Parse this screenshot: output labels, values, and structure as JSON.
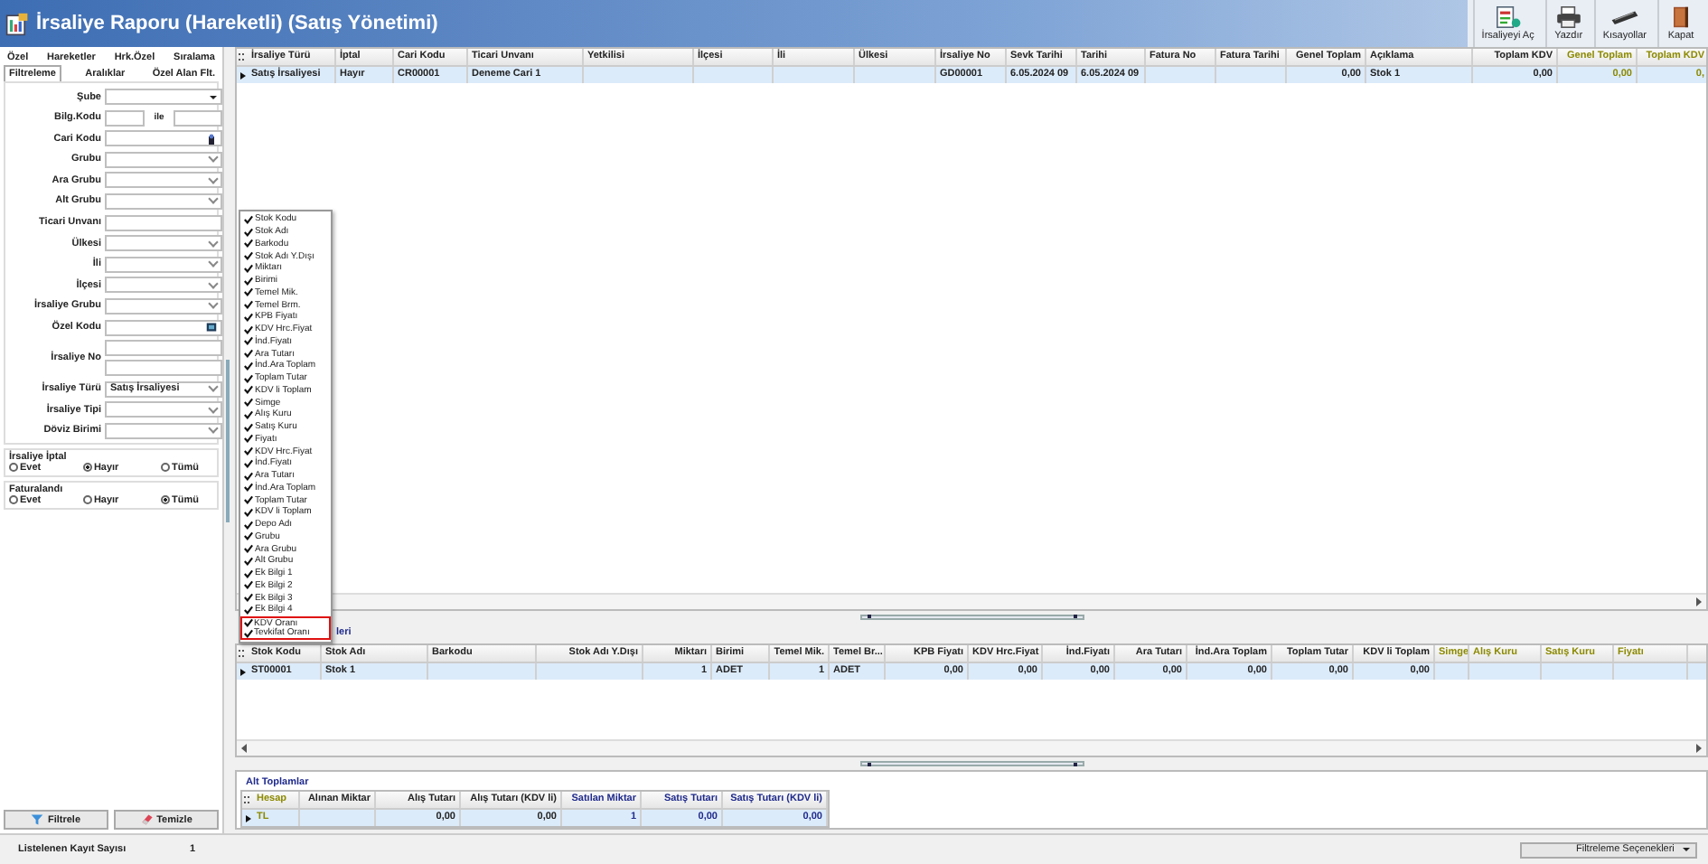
{
  "window": {
    "title": "İrsaliye Raporu (Hareketli) (Satış Yönetimi)"
  },
  "toolbar": [
    {
      "label": "İrsaliyeyi Aç",
      "kind": "document"
    },
    {
      "label": "Yazdır",
      "kind": "printer"
    },
    {
      "label": "Kısayollar",
      "kind": "keyboard"
    },
    {
      "label": "Kapat",
      "kind": "book"
    }
  ],
  "left_panel": {
    "tab_rows": [
      [
        {
          "label": "Özel",
          "selected": false
        },
        {
          "label": "Hareketler",
          "selected": false
        },
        {
          "label": "Hrk.Özel",
          "selected": false
        },
        {
          "label": "Sıralama",
          "selected": false
        }
      ],
      [
        {
          "label": "Filtreleme",
          "selected": true
        },
        {
          "label": "Aralıklar",
          "selected": false
        },
        {
          "label": "Özel Alan Flt.",
          "selected": false
        }
      ]
    ],
    "fields": [
      {
        "label": "Şube",
        "kind": "select"
      },
      {
        "label": "Bilg.Kodu",
        "kind": "range",
        "separator": "ile"
      },
      {
        "label": "Cari Kodu",
        "kind": "lookup"
      },
      {
        "label": "Grubu",
        "kind": "dropdown"
      },
      {
        "label": "Ara Grubu",
        "kind": "dropdown"
      },
      {
        "label": "Alt Grubu",
        "kind": "dropdown"
      },
      {
        "label": "Ticari Unvanı",
        "kind": "text"
      },
      {
        "label": "Ülkesi",
        "kind": "dropdown"
      },
      {
        "label": "İli",
        "kind": "dropdown"
      },
      {
        "label": "İlçesi",
        "kind": "dropdown"
      },
      {
        "label": "İrsaliye Grubu",
        "kind": "dropdown"
      },
      {
        "label": "Özel Kodu",
        "kind": "picker"
      },
      {
        "label": "İrsaliye No",
        "kind": "double"
      },
      {
        "label": "İrsaliye Türü",
        "kind": "dropdown",
        "value": "Satış İrsaliyesi"
      },
      {
        "label": "İrsaliye Tipi",
        "kind": "dropdown"
      },
      {
        "label": "Döviz Birimi",
        "kind": "dropdown"
      }
    ],
    "radio_groups": [
      {
        "title": "İrsaliye İptal",
        "options": [
          {
            "label": "Evet",
            "selected": false
          },
          {
            "label": "Hayır",
            "selected": true
          },
          {
            "label": "Tümü",
            "selected": false
          }
        ]
      },
      {
        "title": "Faturalandı",
        "options": [
          {
            "label": "Evet",
            "selected": false
          },
          {
            "label": "Hayır",
            "selected": false
          },
          {
            "label": "Tümü",
            "selected": true
          }
        ]
      }
    ],
    "buttons": [
      {
        "label": "Filtrele",
        "kind": "filter"
      },
      {
        "label": "Temizle",
        "kind": "eraser"
      }
    ]
  },
  "main_grid": {
    "columns": [
      {
        "label": "İrsaliye Türü",
        "color": "#222222"
      },
      {
        "label": "İptal",
        "color": "#222222"
      },
      {
        "label": "Cari Kodu",
        "color": "#222222"
      },
      {
        "label": "Ticari Unvanı",
        "color": "#222222"
      },
      {
        "label": "Yetkilisi",
        "color": "#222222"
      },
      {
        "label": "İlçesi",
        "color": "#222222"
      },
      {
        "label": "İli",
        "color": "#222222"
      },
      {
        "label": "Ülkesi",
        "color": "#222222"
      },
      {
        "label": "İrsaliye No",
        "color": "#222222"
      },
      {
        "label": "Sevk Tarihi",
        "color": "#222222"
      },
      {
        "label": "Tarihi",
        "color": "#222222"
      },
      {
        "label": "Fatura No",
        "color": "#222222"
      },
      {
        "label": "Fatura Tarihi",
        "color": "#222222"
      },
      {
        "label": "Genel Toplam",
        "color": "#222222"
      },
      {
        "label": "Açıklama",
        "color": "#222222"
      },
      {
        "label": "Toplam KDV",
        "color": "#222222"
      },
      {
        "label": "Genel Toplam",
        "color": "#8c8a00"
      },
      {
        "label": "Toplam KDV",
        "color": "#8c8a00"
      }
    ],
    "rows": [
      [
        "Satış İrsaliyesi",
        "Hayır",
        "CR00001",
        "Deneme Cari 1",
        null,
        null,
        null,
        null,
        "GD00001",
        "6.05.2024 09",
        "6.05.2024 09",
        null,
        null,
        "0,00",
        "Stok 1",
        "0,00",
        "0,00",
        "0,"
      ]
    ]
  },
  "column_menu": {
    "items": [
      {
        "label": "Stok Kodu",
        "checked": true,
        "boxed": false
      },
      {
        "label": "Stok Adı",
        "checked": true,
        "boxed": false
      },
      {
        "label": "Barkodu",
        "checked": true,
        "boxed": false
      },
      {
        "label": "Stok Adı Y.Dışı",
        "checked": true,
        "boxed": false
      },
      {
        "label": "Miktarı",
        "checked": true,
        "boxed": false
      },
      {
        "label": "Birimi",
        "checked": true,
        "boxed": false
      },
      {
        "label": "Temel Mik.",
        "checked": true,
        "boxed": false
      },
      {
        "label": "Temel Brm.",
        "checked": true,
        "boxed": false
      },
      {
        "label": "KPB Fiyatı",
        "checked": true,
        "boxed": false
      },
      {
        "label": "KDV Hrc.Fiyat",
        "checked": true,
        "boxed": false
      },
      {
        "label": "İnd.Fiyatı",
        "checked": true,
        "boxed": false
      },
      {
        "label": "Ara Tutarı",
        "checked": true,
        "boxed": false
      },
      {
        "label": "İnd.Ara Toplam",
        "checked": true,
        "boxed": false
      },
      {
        "label": "Toplam Tutar",
        "checked": true,
        "boxed": false
      },
      {
        "label": "KDV li Toplam",
        "checked": true,
        "boxed": false
      },
      {
        "label": "Simge",
        "checked": true,
        "boxed": false
      },
      {
        "label": "Alış Kuru",
        "checked": true,
        "boxed": false
      },
      {
        "label": "Satış Kuru",
        "checked": true,
        "boxed": false
      },
      {
        "label": "Fiyatı",
        "checked": true,
        "boxed": false
      },
      {
        "label": "KDV Hrc.Fiyat",
        "checked": true,
        "boxed": false
      },
      {
        "label": "İnd.Fiyatı",
        "checked": true,
        "boxed": false
      },
      {
        "label": "Ara Tutarı",
        "checked": true,
        "boxed": false
      },
      {
        "label": "İnd.Ara Toplam",
        "checked": true,
        "boxed": false
      },
      {
        "label": "Toplam Tutar",
        "checked": true,
        "boxed": false
      },
      {
        "label": "KDV li Toplam",
        "checked": true,
        "boxed": false
      },
      {
        "label": "Depo Adı",
        "checked": true,
        "boxed": false
      },
      {
        "label": "Grubu",
        "checked": true,
        "boxed": false
      },
      {
        "label": "Ara Grubu",
        "checked": true,
        "boxed": false
      },
      {
        "label": "Alt Grubu",
        "checked": true,
        "boxed": false
      },
      {
        "label": "Ek Bilgi 1",
        "checked": true,
        "boxed": false
      },
      {
        "label": "Ek Bilgi 2",
        "checked": true,
        "boxed": false
      },
      {
        "label": "Ek Bilgi 3",
        "checked": true,
        "boxed": false
      },
      {
        "label": "Ek Bilgi 4",
        "checked": true,
        "boxed": false
      },
      {
        "label": "KDV Oranı",
        "checked": true,
        "boxed": true
      },
      {
        "label": "Tevkifat Oranı",
        "checked": true,
        "boxed": true
      }
    ]
  },
  "detail_section": {
    "title": "leri"
  },
  "detail_grid": {
    "columns": [
      {
        "label": "Stok Kodu",
        "color": "#222222"
      },
      {
        "label": "Stok Adı",
        "color": "#222222"
      },
      {
        "label": "Barkodu",
        "color": "#222222"
      },
      {
        "label": "Stok Adı Y.Dışı",
        "color": "#222222"
      },
      {
        "label": "Miktarı",
        "color": "#222222"
      },
      {
        "label": "Birimi",
        "color": "#222222"
      },
      {
        "label": "Temel Mik.",
        "color": "#222222"
      },
      {
        "label": "Temel Br...",
        "color": "#222222"
      },
      {
        "label": "KPB Fiyatı",
        "color": "#222222"
      },
      {
        "label": "KDV Hrc.Fiyat",
        "color": "#222222"
      },
      {
        "label": "İnd.Fiyatı",
        "color": "#222222"
      },
      {
        "label": "Ara Tutarı",
        "color": "#222222"
      },
      {
        "label": "İnd.Ara Toplam",
        "color": "#222222"
      },
      {
        "label": "Toplam Tutar",
        "color": "#222222"
      },
      {
        "label": "KDV li Toplam",
        "color": "#222222"
      },
      {
        "label": "Simge",
        "color": "#8c8a00"
      },
      {
        "label": "Alış Kuru",
        "color": "#8c8a00"
      },
      {
        "label": "Satış Kuru",
        "color": "#8c8a00"
      },
      {
        "label": "Fiyatı",
        "color": "#8c8a00"
      }
    ],
    "rows": [
      [
        "ST00001",
        "Stok 1",
        null,
        null,
        "1",
        "ADET",
        "1",
        "ADET",
        "0,00",
        "0,00",
        "0,00",
        "0,00",
        "0,00",
        "0,00",
        "0,00",
        null,
        null,
        null,
        null
      ]
    ]
  },
  "totals": {
    "title": "Alt Toplamlar",
    "columns": [
      {
        "label": "Hesap",
        "color": "#8c8a00"
      },
      {
        "label": "Alınan Miktar",
        "color": "#222222"
      },
      {
        "label": "Alış Tutarı",
        "color": "#222222"
      },
      {
        "label": "Alış Tutarı (KDV li)",
        "color": "#222222"
      },
      {
        "label": "Satılan Miktar",
        "color": "#1f2a8c"
      },
      {
        "label": "Satış Tutarı",
        "color": "#1f2a8c"
      },
      {
        "label": "Satış Tutarı (KDV li)",
        "color": "#1f2a8c"
      }
    ],
    "rows": [
      [
        "TL",
        null,
        "0,00",
        "0,00",
        "1",
        "0,00",
        "0,00"
      ]
    ]
  },
  "status_bar": {
    "label": "Listelenen Kayıt Sayısı",
    "count": "1",
    "options_button": "Filtreleme Seçenekleri"
  }
}
